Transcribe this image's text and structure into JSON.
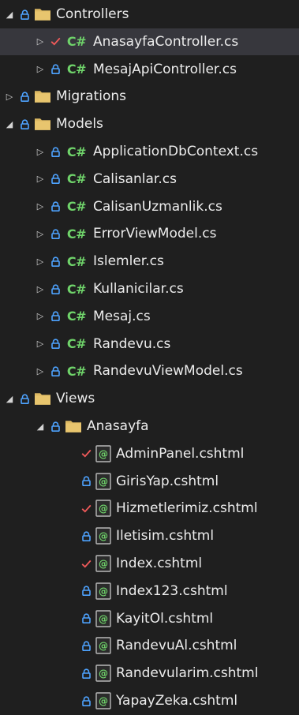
{
  "colors": {
    "background": "#1f1f1f",
    "selected_row": "#37373d",
    "lock": "#4ea3ff",
    "check": "#f05a5a",
    "csharp": "#6fd36a",
    "folder": "#dcb862"
  },
  "tree": {
    "rows": [
      {
        "label": "Controllers",
        "level": 0,
        "expander": "expanded",
        "status": "lock-icon",
        "kind": "folder-icon"
      },
      {
        "label": "AnasayfaController.cs",
        "level": 1,
        "expander": "collapsed",
        "status": "check-icon",
        "kind": "csharp-file-icon",
        "kind_text": "C#",
        "selected": true
      },
      {
        "label": "MesajApiController.cs",
        "level": 1,
        "expander": "collapsed",
        "status": "lock-icon",
        "kind": "csharp-file-icon",
        "kind_text": "C#"
      },
      {
        "label": "Migrations",
        "level": 0,
        "expander": "collapsed",
        "status": "lock-icon",
        "kind": "folder-icon"
      },
      {
        "label": "Models",
        "level": 0,
        "expander": "expanded",
        "status": "lock-icon",
        "kind": "folder-icon"
      },
      {
        "label": "ApplicationDbContext.cs",
        "level": 1,
        "expander": "collapsed",
        "status": "lock-icon",
        "kind": "csharp-file-icon",
        "kind_text": "C#"
      },
      {
        "label": "Calisanlar.cs",
        "level": 1,
        "expander": "collapsed",
        "status": "lock-icon",
        "kind": "csharp-file-icon",
        "kind_text": "C#"
      },
      {
        "label": "CalisanUzmanlik.cs",
        "level": 1,
        "expander": "collapsed",
        "status": "lock-icon",
        "kind": "csharp-file-icon",
        "kind_text": "C#"
      },
      {
        "label": "ErrorViewModel.cs",
        "level": 1,
        "expander": "collapsed",
        "status": "lock-icon",
        "kind": "csharp-file-icon",
        "kind_text": "C#"
      },
      {
        "label": "Islemler.cs",
        "level": 1,
        "expander": "collapsed",
        "status": "lock-icon",
        "kind": "csharp-file-icon",
        "kind_text": "C#"
      },
      {
        "label": "Kullanicilar.cs",
        "level": 1,
        "expander": "collapsed",
        "status": "lock-icon",
        "kind": "csharp-file-icon",
        "kind_text": "C#"
      },
      {
        "label": "Mesaj.cs",
        "level": 1,
        "expander": "collapsed",
        "status": "lock-icon",
        "kind": "csharp-file-icon",
        "kind_text": "C#"
      },
      {
        "label": "Randevu.cs",
        "level": 1,
        "expander": "collapsed",
        "status": "lock-icon",
        "kind": "csharp-file-icon",
        "kind_text": "C#"
      },
      {
        "label": "RandevuViewModel.cs",
        "level": 1,
        "expander": "collapsed",
        "status": "lock-icon",
        "kind": "csharp-file-icon",
        "kind_text": "C#"
      },
      {
        "label": "Views",
        "level": 0,
        "expander": "expanded",
        "status": "lock-icon",
        "kind": "folder-icon"
      },
      {
        "label": "Anasayfa",
        "level": 1,
        "expander": "expanded",
        "status": "lock-icon",
        "kind": "folder-icon"
      },
      {
        "label": "AdminPanel.cshtml",
        "level": 2,
        "expander": "none",
        "status": "check-icon",
        "kind": "razor-file-icon"
      },
      {
        "label": "GirisYap.cshtml",
        "level": 2,
        "expander": "none",
        "status": "lock-icon",
        "kind": "razor-file-icon"
      },
      {
        "label": "Hizmetlerimiz.cshtml",
        "level": 2,
        "expander": "none",
        "status": "check-icon",
        "kind": "razor-file-icon"
      },
      {
        "label": "Iletisim.cshtml",
        "level": 2,
        "expander": "none",
        "status": "lock-icon",
        "kind": "razor-file-icon"
      },
      {
        "label": "Index.cshtml",
        "level": 2,
        "expander": "none",
        "status": "check-icon",
        "kind": "razor-file-icon"
      },
      {
        "label": "Index123.cshtml",
        "level": 2,
        "expander": "none",
        "status": "lock-icon",
        "kind": "razor-file-icon"
      },
      {
        "label": "KayitOl.cshtml",
        "level": 2,
        "expander": "none",
        "status": "lock-icon",
        "kind": "razor-file-icon"
      },
      {
        "label": "RandevuAl.cshtml",
        "level": 2,
        "expander": "none",
        "status": "lock-icon",
        "kind": "razor-file-icon"
      },
      {
        "label": "Randevularim.cshtml",
        "level": 2,
        "expander": "none",
        "status": "lock-icon",
        "kind": "razor-file-icon"
      },
      {
        "label": "YapayZeka.cshtml",
        "level": 2,
        "expander": "none",
        "status": "lock-icon",
        "kind": "razor-file-icon"
      }
    ]
  }
}
